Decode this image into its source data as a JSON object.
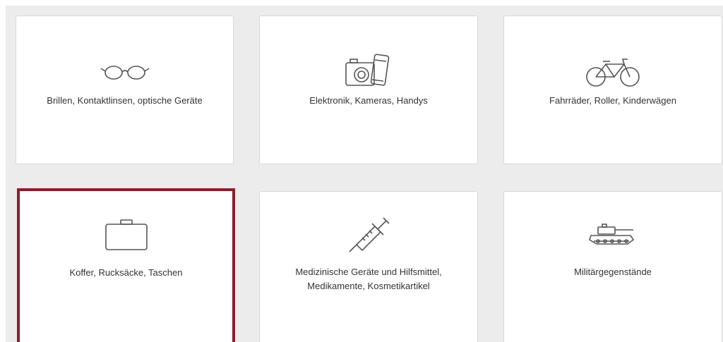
{
  "categories": [
    {
      "label": "Brillen, Kontaktlinsen, optische Geräte",
      "icon": "glasses-icon"
    },
    {
      "label": "Elektronik, Kameras, Handys",
      "icon": "camera-phone-icon"
    },
    {
      "label": "Fahrräder, Roller, Kinderwägen",
      "icon": "bicycle-icon"
    },
    {
      "label": "Koffer, Rucksäcke, Taschen",
      "icon": "suitcase-icon",
      "highlighted": true
    },
    {
      "label": "Medizinische Geräte und Hilfsmittel, Medikamente, Kosmetikartikel",
      "icon": "syringe-icon"
    },
    {
      "label": "Militärgegenstände",
      "icon": "tank-icon"
    }
  ],
  "colors": {
    "background": "#ececec",
    "tile": "#ffffff",
    "highlight_border": "#8b1e2c",
    "text": "#333333",
    "icon_stroke": "#555555"
  }
}
